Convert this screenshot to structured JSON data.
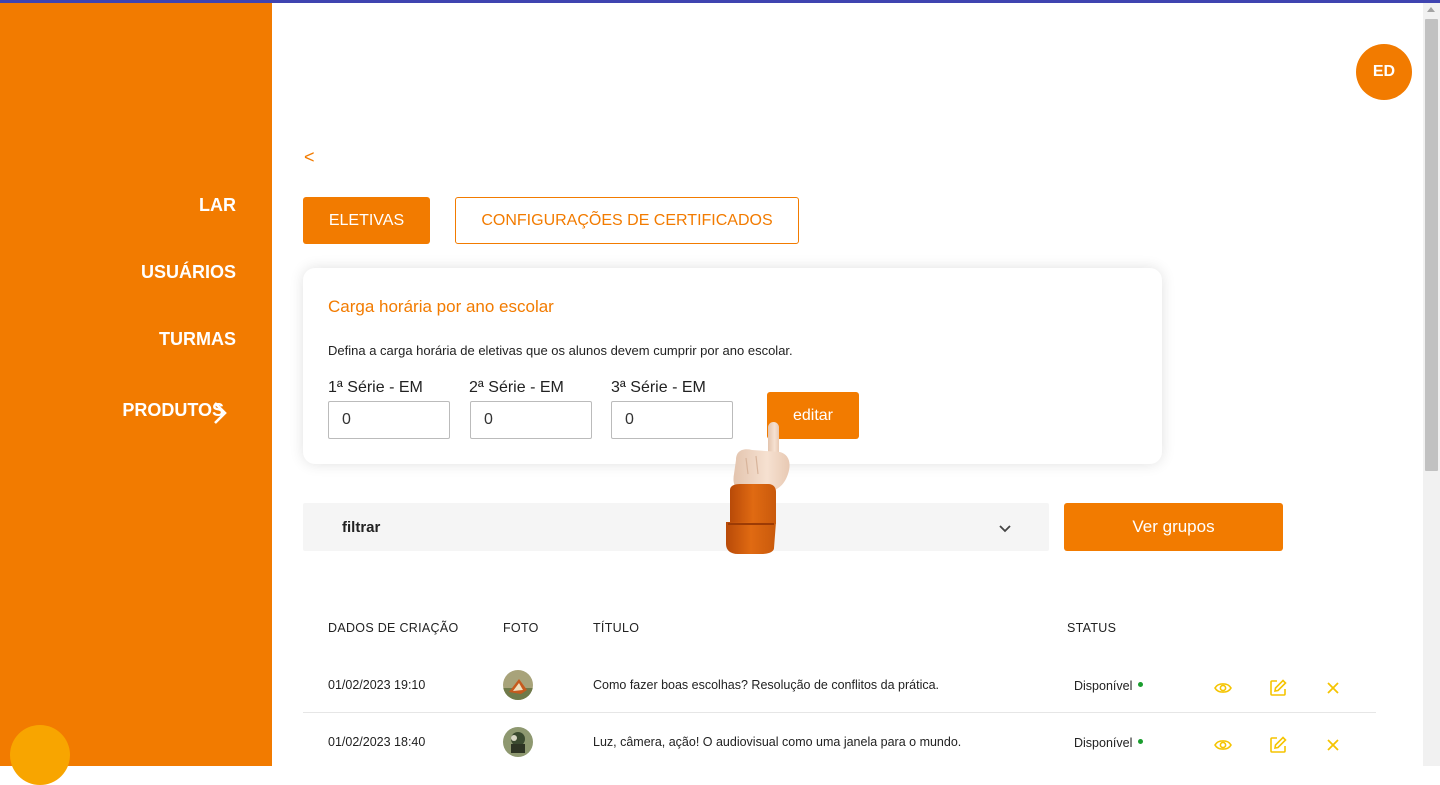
{
  "sidebar": {
    "items": [
      {
        "label": "LAR"
      },
      {
        "label": "USUÁRIOS"
      },
      {
        "label": "TURMAS"
      },
      {
        "label": "PRODUTOS"
      }
    ],
    "help_glyph": " "
  },
  "header": {
    "avatar_initials": "ED"
  },
  "nav": {
    "back": "<"
  },
  "tabs": [
    {
      "label": "ELETIVAS",
      "active": true
    },
    {
      "label": "CONFIGURAÇÕES DE CERTIFICADOS",
      "active": false
    }
  ],
  "workload_card": {
    "title": "Carga horária por ano escolar",
    "description": "Defina a carga horária de eletivas que os alunos devem cumprir por ano escolar.",
    "fields": [
      {
        "label": "1ª Série - EM",
        "value": "0"
      },
      {
        "label": "2ª Série - EM",
        "value": "0"
      },
      {
        "label": "3ª Série - EM",
        "value": "0"
      }
    ],
    "edit_label": "editar"
  },
  "filter": {
    "label": "filtrar",
    "icon": "chevron-down-icon"
  },
  "groups_button": {
    "label": "Ver grupos"
  },
  "table": {
    "headers": [
      "DADOS DE CRIAÇÃO",
      "FOTO",
      "TÍTULO",
      "STATUS"
    ],
    "rows": [
      {
        "date": "01/02/2023 19:10",
        "title": "Como fazer boas escolhas? Resolução de conflitos da prática.",
        "status": "Disponível"
      },
      {
        "date": "01/02/2023 18:40",
        "title": "Luz, câmera, ação! O audiovisual como uma janela para o mundo.",
        "status": "Disponível"
      }
    ]
  },
  "colors": {
    "brand_orange": "#f27b00",
    "action_yellow": "#f5c400",
    "status_green": "#1a9d2e",
    "top_line": "#3f44b0"
  }
}
